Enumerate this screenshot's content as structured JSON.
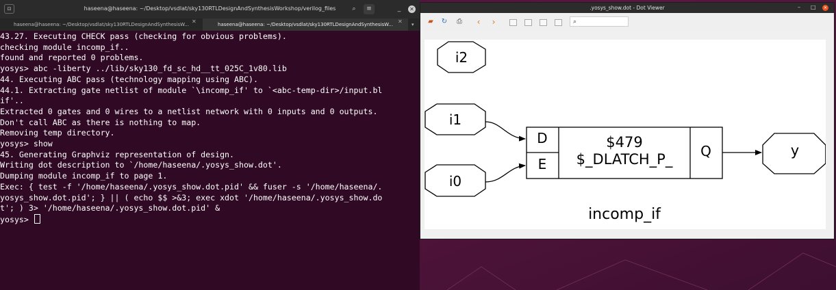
{
  "terminal": {
    "title": "haseena@haseena: ~/Desktop/vsdlat/sky130RTLDesignAndSynthesisWorkshop/verilog_files",
    "tabs": [
      {
        "label": "haseena@haseena: ~/Desktop/vsdlat/sky130RTLDesignAndSynthesisW...",
        "active": false
      },
      {
        "label": "haseena@haseena: ~/Desktop/vsdlat/sky130RTLDesignAndSynthesisW...",
        "active": true
      }
    ],
    "lines": [
      "43.27. Executing CHECK pass (checking for obvious problems).",
      "checking module incomp_if..",
      "found and reported 0 problems.",
      "",
      "yosys> abc -liberty ../lib/sky130_fd_sc_hd__tt_025C_1v80.lib",
      "",
      "44. Executing ABC pass (technology mapping using ABC).",
      "",
      "44.1. Extracting gate netlist of module `\\incomp_if' to `<abc-temp-dir>/input.bl",
      "if'..",
      "Extracted 0 gates and 0 wires to a netlist network with 0 inputs and 0 outputs.",
      "Don't call ABC as there is nothing to map.",
      "Removing temp directory.",
      "",
      "yosys> show",
      "",
      "45. Generating Graphviz representation of design.",
      "Writing dot description to `/home/haseena/.yosys_show.dot'.",
      "Dumping module incomp_if to page 1.",
      "Exec: { test -f '/home/haseena/.yosys_show.dot.pid' && fuser -s '/home/haseena/.",
      "yosys_show.dot.pid'; } || ( echo $$ >&3; exec xdot '/home/haseena/.yosys_show.do",
      "t'; ) 3> '/home/haseena/.yosys_show.dot.pid' &",
      ""
    ],
    "prompt": "yosys> ",
    "icons": {
      "menu": "terminal-icon",
      "search": "search-icon",
      "hamburger": "menu-icon",
      "minimize": "minimize-icon",
      "close": "close-icon"
    }
  },
  "viewer": {
    "title": ".yosys_show.dot - Dot Viewer",
    "toolbar": [
      "open-icon",
      "reload-icon",
      "print-icon",
      "back-icon",
      "forward-icon",
      "zoom-in-icon",
      "zoom-out-icon",
      "zoom-fit-icon",
      "zoom-100-icon",
      "find-icon"
    ],
    "graph": {
      "inputs": [
        "i2",
        "i1",
        "i0"
      ],
      "cell": {
        "ports_in": [
          "D",
          "E"
        ],
        "id": "$479",
        "type": "$_DLATCH_P_",
        "port_out": "Q"
      },
      "output": "y",
      "module_label": "incomp_if"
    }
  },
  "colors": {
    "terminal_bg": "#300a24",
    "desktop_bg": "#4b1238",
    "close_accent": "#e95420"
  }
}
